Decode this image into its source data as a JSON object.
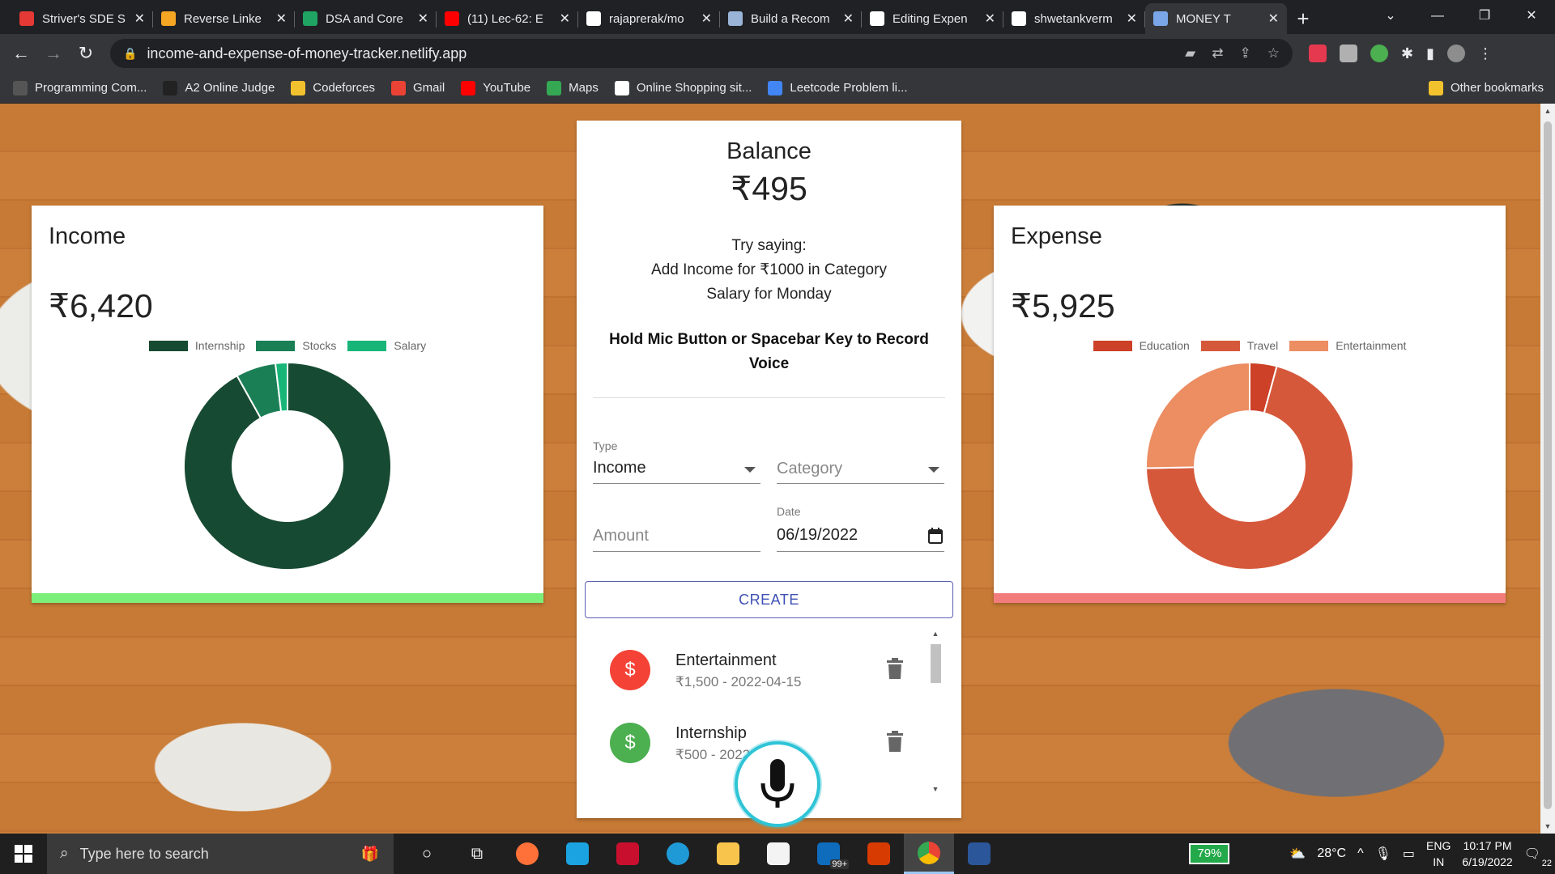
{
  "browser": {
    "tabs": [
      {
        "label": "Striver's SDE S",
        "color": "#e53935",
        "active": false
      },
      {
        "label": "Reverse Linke",
        "color": "#f5a623",
        "active": false
      },
      {
        "label": "DSA and Core",
        "color": "#1fa463",
        "active": false
      },
      {
        "label": "(11) Lec-62: E",
        "color": "#ff0000",
        "active": false
      },
      {
        "label": "rajaprerak/mo",
        "color": "#ffffff",
        "active": false
      },
      {
        "label": "Build a Recom",
        "color": "#9ab4d8",
        "active": false
      },
      {
        "label": "Editing Expen",
        "color": "#ffffff",
        "active": false
      },
      {
        "label": "shwetankverm",
        "color": "#ffffff",
        "active": false
      },
      {
        "label": "MONEY T",
        "color": "#7aa6e8",
        "active": true
      }
    ],
    "new_tab": "+",
    "url": "income-and-expense-of-money-tracker.netlify.app",
    "bookmarks": [
      {
        "label": "Programming Com...",
        "color": "#555555"
      },
      {
        "label": "A2 Online Judge",
        "color": "#222222"
      },
      {
        "label": "Codeforces",
        "color": "#f2c12e"
      },
      {
        "label": "Gmail",
        "color": "#ea4335"
      },
      {
        "label": "YouTube",
        "color": "#ff0000"
      },
      {
        "label": "Maps",
        "color": "#34a853"
      },
      {
        "label": "Online Shopping sit...",
        "color": "#ffffff"
      },
      {
        "label": "Leetcode Problem li...",
        "color": "#4285f4"
      }
    ],
    "other_bookmarks": "Other bookmarks"
  },
  "app": {
    "income": {
      "title": "Income",
      "amount": "₹6,420",
      "legend": [
        "Internship",
        "Stocks",
        "Salary"
      ],
      "accent": "#7bef79"
    },
    "expense": {
      "title": "Expense",
      "amount": "₹5,925",
      "legend": [
        "Education",
        "Travel",
        "Entertainment"
      ],
      "accent": "#f27c7c"
    },
    "balance": {
      "title": "Balance",
      "amount": "₹495",
      "hint_lines": [
        "Try saying:",
        "Add Income for ₹1000 in Category",
        "Salary for Monday"
      ],
      "hold_text": "Hold Mic Button or Spacebar Key to Record Voice"
    },
    "form": {
      "type_label": "Type",
      "type_value": "Income",
      "category_placeholder": "Category",
      "amount_placeholder": "Amount",
      "date_label": "Date",
      "date_value": "06/19/2022",
      "create_label": "CREATE"
    },
    "transactions": [
      {
        "category": "Entertainment",
        "detail": "₹1,500 - 2022-04-15",
        "type": "expense",
        "color": "#f44336"
      },
      {
        "category": "Internship",
        "detail": "₹500 - 2022-",
        "type": "income",
        "color": "#4caf50"
      }
    ]
  },
  "chart_data": [
    {
      "type": "pie",
      "title": "",
      "categories": [
        "Internship",
        "Stocks",
        "Salary"
      ],
      "values": [
        5900,
        400,
        120
      ],
      "colors": [
        "#174a32",
        "#1a7f55",
        "#17b678"
      ],
      "legend": "top"
    },
    {
      "type": "pie",
      "title": "",
      "categories": [
        "Education",
        "Travel",
        "Entertainment"
      ],
      "values": [
        250,
        4175,
        1500
      ],
      "colors": [
        "#cc4128",
        "#d6583b",
        "#ec8d62"
      ],
      "legend": "top"
    }
  ],
  "taskbar": {
    "search_placeholder": "Type here to search",
    "battery": "79%",
    "weather": "28°C",
    "lang_top": "ENG",
    "lang_bottom": "IN",
    "time": "10:17 PM",
    "date": "6/19/2022",
    "notifications": "22",
    "mail_badge": "99+"
  }
}
